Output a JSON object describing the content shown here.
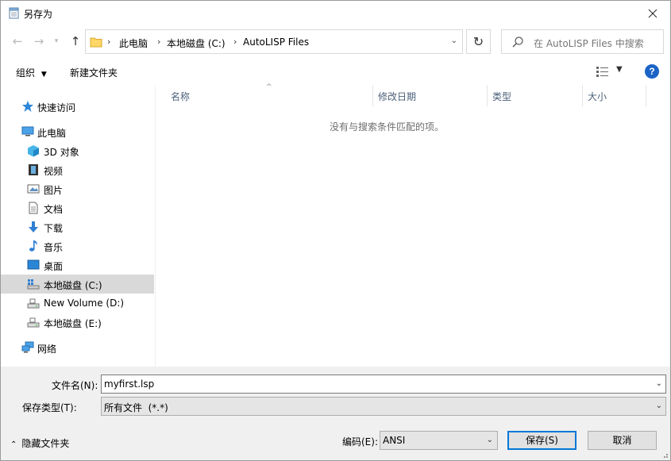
{
  "window": {
    "title": "另存为"
  },
  "nav": {
    "breadcrumbs": [
      "此电脑",
      "本地磁盘 (C:)",
      "AutoLISP Files"
    ],
    "search_placeholder": "在 AutoLISP Files 中搜索"
  },
  "toolbar": {
    "organize_label": "组织",
    "new_folder_label": "新建文件夹"
  },
  "sidebar": {
    "items": [
      {
        "label": "快速访问",
        "icon": "star-icon"
      },
      {
        "label": "此电脑",
        "icon": "computer-icon"
      },
      {
        "label": "3D 对象",
        "icon": "cube-3d-icon"
      },
      {
        "label": "视频",
        "icon": "video-icon"
      },
      {
        "label": "图片",
        "icon": "picture-icon"
      },
      {
        "label": "文档",
        "icon": "document-icon"
      },
      {
        "label": "下载",
        "icon": "download-icon"
      },
      {
        "label": "音乐",
        "icon": "music-icon"
      },
      {
        "label": "桌面",
        "icon": "desktop-icon"
      },
      {
        "label": "本地磁盘 (C:)",
        "icon": "drive-os-icon",
        "selected": true
      },
      {
        "label": "New Volume (D:)",
        "icon": "drive-icon"
      },
      {
        "label": "本地磁盘 (E:)",
        "icon": "drive-icon"
      },
      {
        "label": "网络",
        "icon": "network-icon"
      }
    ]
  },
  "list": {
    "columns": [
      "名称",
      "修改日期",
      "类型",
      "大小"
    ],
    "empty_message": "没有与搜索条件匹配的项。"
  },
  "form": {
    "filename_label": "文件名(N):",
    "filename_value": "myfirst.lsp",
    "filetype_label": "保存类型(T):",
    "filetype_value": "所有文件  (*.*)",
    "hide_folders_label": "隐藏文件夹",
    "encoding_label": "编码(E):",
    "encoding_value": "ANSI",
    "save_label": "保存(S)",
    "cancel_label": "取消"
  },
  "colors": {
    "accent": "#0078d7",
    "help": "#1b63c6",
    "selected_bg": "#d9d9d9",
    "bottom_bg": "#f0f0f0"
  }
}
